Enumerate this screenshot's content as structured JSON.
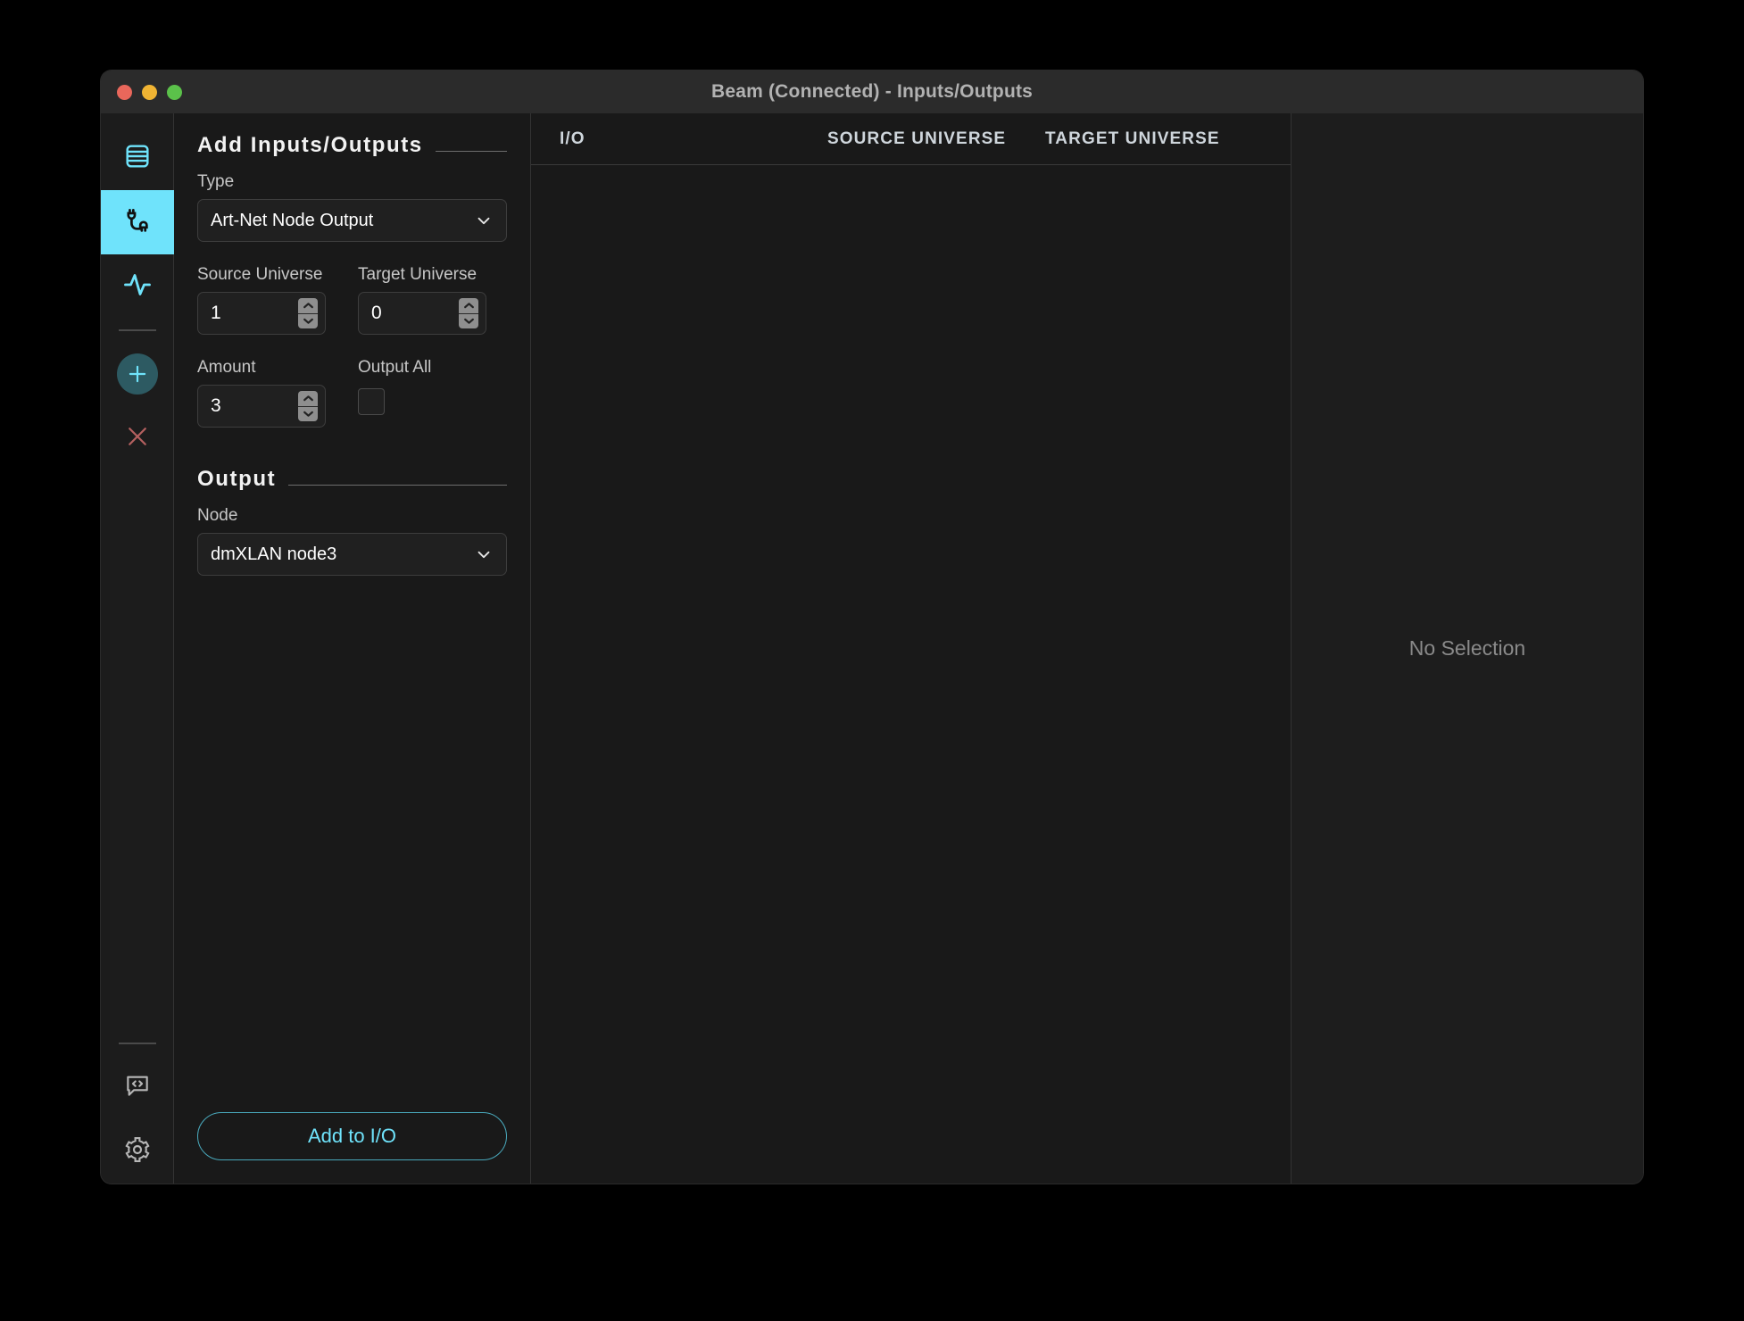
{
  "window": {
    "title": "Beam (Connected) - Inputs/Outputs",
    "traffic_lights": [
      "close",
      "minimize",
      "maximize"
    ],
    "accent_color": "#6fe3fb",
    "panel_bg": "#191919",
    "titlebar_bg": "#2b2b2b"
  },
  "rail": {
    "items": [
      {
        "icon": "list-icon",
        "active": false,
        "color": "#6fe3fb"
      },
      {
        "icon": "plug-cable-icon",
        "active": true,
        "color": "#111111"
      },
      {
        "icon": "activity-pulse-icon",
        "active": false,
        "color": "#6fe3fb"
      },
      {
        "icon": "plus-icon",
        "active": false,
        "color": "#6fe3fb"
      },
      {
        "icon": "close-x-icon",
        "active": false,
        "color": "#b4605f"
      }
    ],
    "bottom_items": [
      {
        "icon": "code-bubble-icon",
        "color": "#b6b6b6"
      },
      {
        "icon": "gear-icon",
        "color": "#b6b6b6"
      }
    ]
  },
  "form": {
    "section_title": "Add Inputs/Outputs",
    "type": {
      "label": "Type",
      "value": "Art-Net Node Output",
      "placeholder": "Select type"
    },
    "source_universe": {
      "label": "Source Universe",
      "value": "1"
    },
    "target_universe": {
      "label": "Target Universe",
      "value": "0"
    },
    "amount": {
      "label": "Amount",
      "value": "3"
    },
    "output_all": {
      "label": "Output All",
      "checked": false
    },
    "output_section": {
      "title": "Output",
      "node": {
        "label": "Node",
        "value": "dmXLAN node3",
        "placeholder": "Select node"
      }
    },
    "submit_label": "Add to I/O"
  },
  "table": {
    "columns": [
      "I/O",
      "SOURCE UNIVERSE",
      "TARGET UNIVERSE"
    ],
    "rows": []
  },
  "detail": {
    "empty_text": "No Selection"
  }
}
